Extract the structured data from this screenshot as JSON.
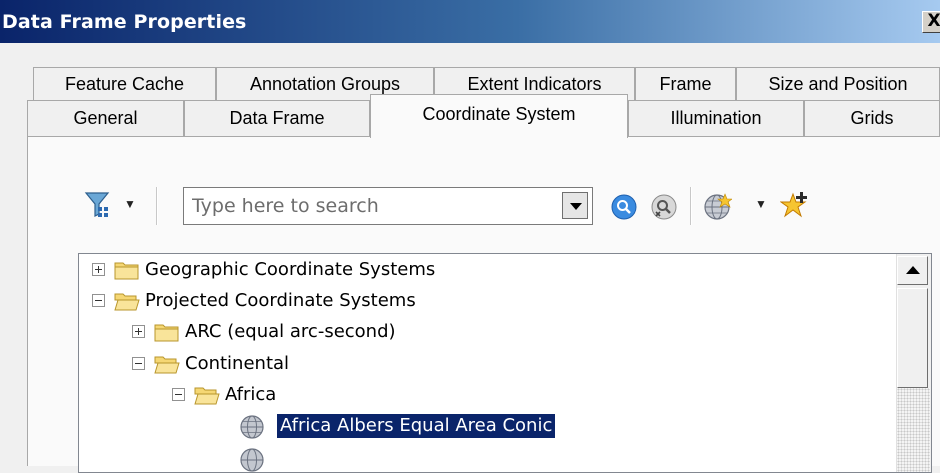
{
  "window": {
    "title": "Data Frame Properties",
    "close_label": "X"
  },
  "tabs": {
    "back_row": [
      "Feature Cache",
      "Annotation Groups",
      "Extent Indicators",
      "Frame",
      "Size and Position"
    ],
    "front_row": [
      "General",
      "Data Frame",
      "Coordinate System",
      "Illumination",
      "Grids"
    ],
    "active": "Coordinate System"
  },
  "search": {
    "placeholder": "Type here to search",
    "value": ""
  },
  "toolbar": {
    "icons": [
      "filter-icon",
      "search-icon",
      "clear-search-icon",
      "globe-icon",
      "favorite-star-icon"
    ]
  },
  "tree": {
    "items": [
      {
        "label": "Geographic Coordinate Systems",
        "level": 0,
        "expanded": false,
        "icon": "folder-icon"
      },
      {
        "label": "Projected Coordinate Systems",
        "level": 0,
        "expanded": true,
        "icon": "open-folder-icon"
      },
      {
        "label": "ARC (equal arc-second)",
        "level": 1,
        "expanded": false,
        "icon": "folder-icon"
      },
      {
        "label": "Continental",
        "level": 1,
        "expanded": true,
        "icon": "open-folder-icon"
      },
      {
        "label": "Africa",
        "level": 2,
        "expanded": true,
        "icon": "open-folder-icon"
      },
      {
        "label": "Africa Albers Equal Area Conic",
        "level": 3,
        "selected": true,
        "icon": "coordinate-system-globe-icon"
      }
    ]
  },
  "colors": {
    "title_bar_start": "#0a246a",
    "title_bar_end": "#a6caf0",
    "selection": "#0a246a",
    "folder": "#f5d774"
  }
}
